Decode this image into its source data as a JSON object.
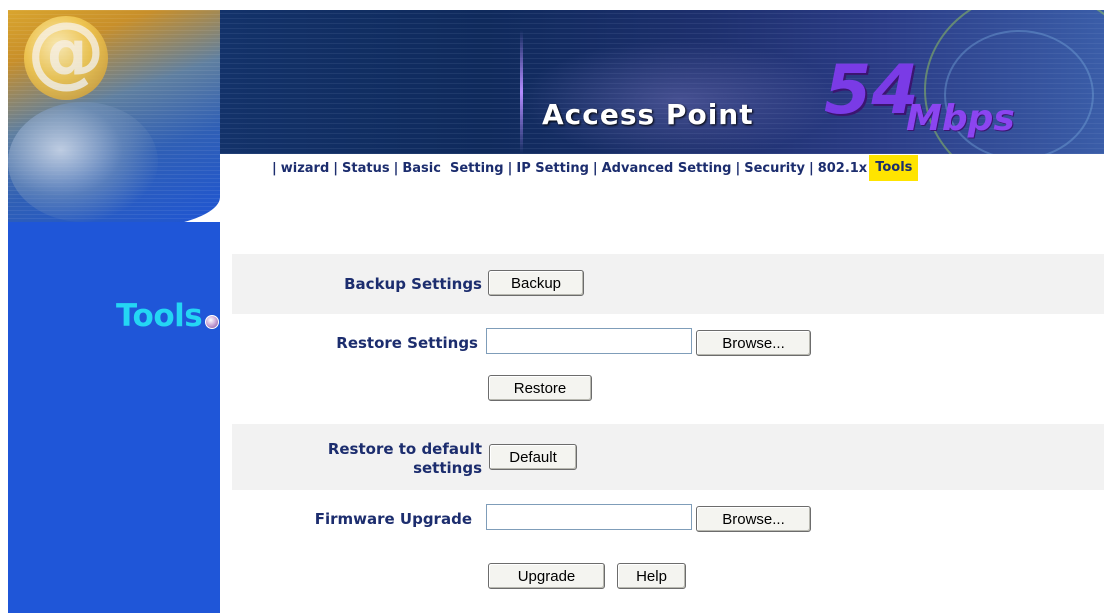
{
  "banner": {
    "logo_glyph": "@",
    "title": "Access Point",
    "speed": "54",
    "speed_unit": "Mbps"
  },
  "nav": {
    "items": [
      {
        "label": "wizard",
        "active": false
      },
      {
        "label": "Status",
        "active": false
      },
      {
        "label": "Basic  Setting",
        "active": false
      },
      {
        "label": "IP Setting",
        "active": false
      },
      {
        "label": "Advanced Setting",
        "active": false
      },
      {
        "label": "Security",
        "active": false
      },
      {
        "label": "802.1x",
        "active": false
      },
      {
        "label": "Tools",
        "active": true
      }
    ]
  },
  "sidebar": {
    "page_heading": "Tools"
  },
  "form": {
    "backup": {
      "label": "Backup Settings",
      "button": "Backup"
    },
    "restore": {
      "label": "Restore Settings",
      "file_value": "",
      "browse_button": "Browse...",
      "restore_button": "Restore"
    },
    "default": {
      "label_line1": "Restore to default",
      "label_line2": "settings",
      "button": "Default"
    },
    "firmware": {
      "label": "Firmware Upgrade",
      "file_value": "",
      "browse_button": "Browse...",
      "upgrade_button": "Upgrade",
      "help_button": "Help"
    }
  },
  "colors": {
    "sidebar_blue": "#1f56d8",
    "heading_cyan": "#24d6f4",
    "nav_text": "#1c2d6e",
    "active_tab_bg": "#ffe400",
    "label_text": "#1c2d6e",
    "band_gray": "#f2f2f2",
    "speed_purple": "#7a3be6"
  }
}
